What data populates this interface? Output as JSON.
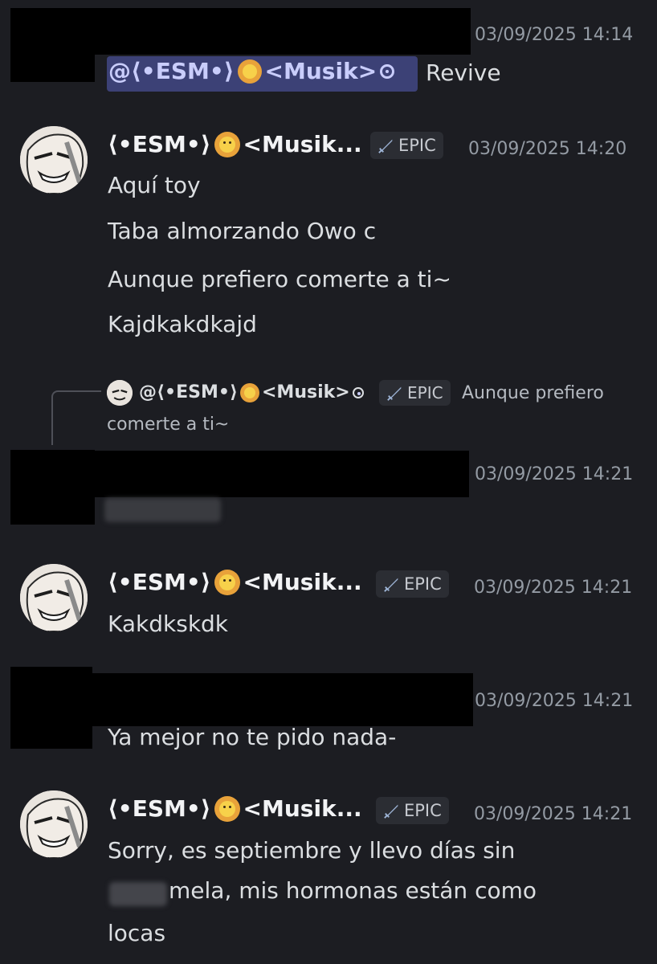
{
  "messages": [
    {
      "timestamp": "03/09/2025 14:14",
      "mention": "@⟨•ESM•⟩",
      "mention_suffix": "<Musik>",
      "text": "Revive"
    },
    {
      "author": "⟨•ESM•⟩",
      "author_suffix": "<Musik...",
      "badge": "EPIC",
      "timestamp": "03/09/2025 14:20",
      "lines": [
        "Aquí toy",
        "Taba almorzando Owo c",
        "Aunque prefiero comerte a ti~",
        "Kajdkakdkajd"
      ]
    },
    {
      "timestamp": "03/09/2025 14:21",
      "reply": {
        "author": "@⟨•ESM•⟩",
        "author_suffix": "<Musik>",
        "badge": "EPIC",
        "text_line1": "Aunque prefiero",
        "text_line2": "comerte a ti~"
      }
    },
    {
      "author": "⟨•ESM•⟩",
      "author_suffix": "<Musik...",
      "badge": "EPIC",
      "timestamp": "03/09/2025 14:21",
      "lines": [
        "Kakdkskdk"
      ]
    },
    {
      "timestamp": "03/09/2025 14:21",
      "lines": [
        "Ya mejor no te pido nada-"
      ]
    },
    {
      "author": "⟨•ESM•⟩",
      "author_suffix": "<Musik...",
      "badge": "EPIC",
      "timestamp": "03/09/2025 14:21",
      "lines": [
        "Sorry, es septiembre y llevo días sin",
        "mela, mis hormonas están como",
        "locas"
      ]
    }
  ],
  "icons": {
    "role_badge": "sword-icon",
    "name_emoji": "lion-icon",
    "mention_emoji": "spiral-icon"
  },
  "colors": {
    "background": "#1c1d22",
    "mention_bg": "#3c4176",
    "badge_bg": "#2b2d33",
    "timestamp": "#949ba4"
  }
}
